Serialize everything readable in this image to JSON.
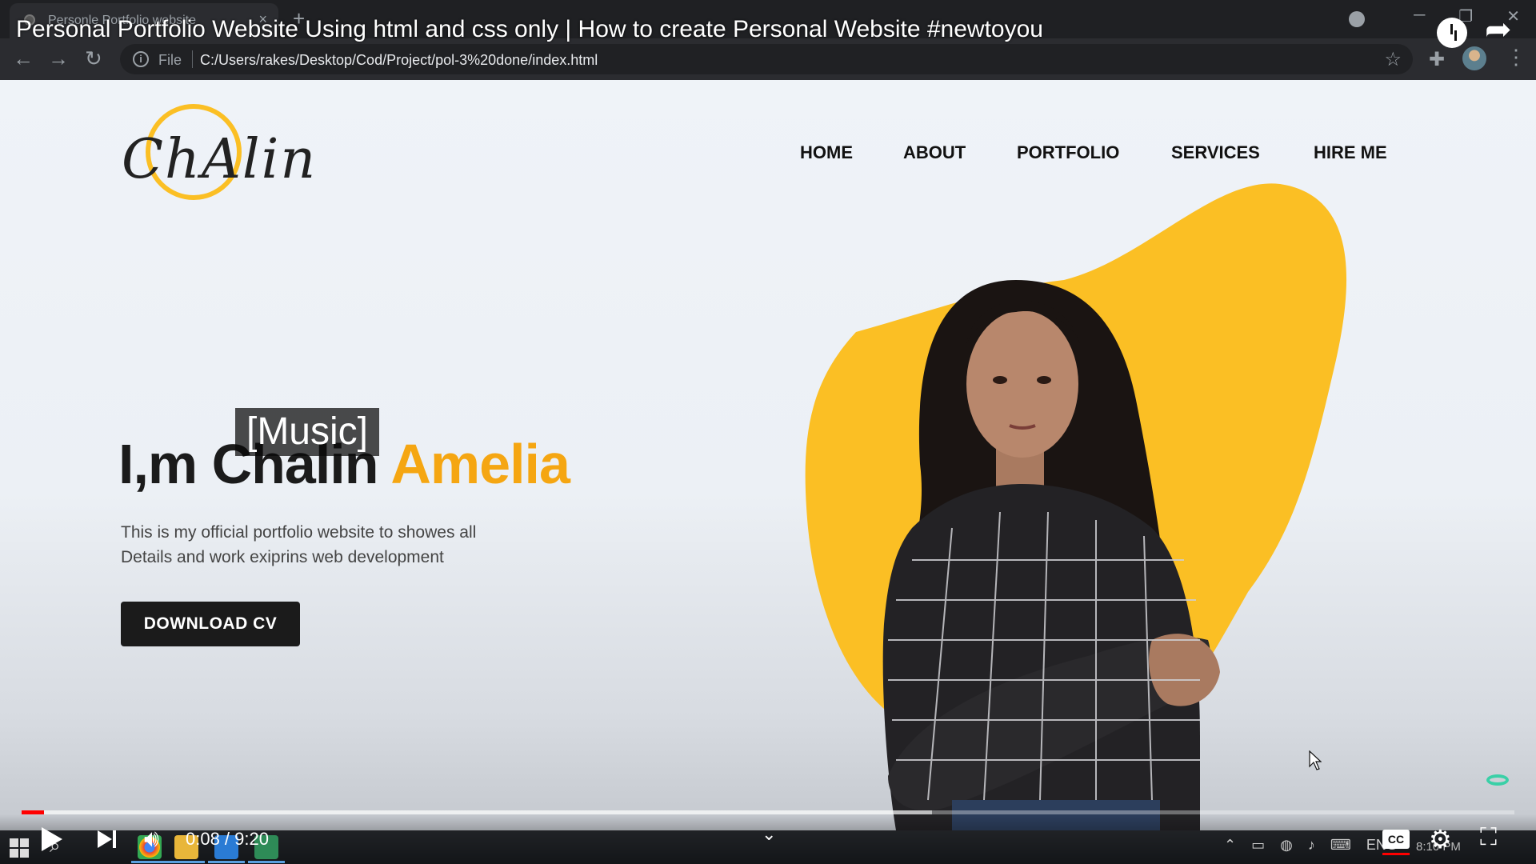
{
  "browser": {
    "tab_title": "Personle Portfolio website",
    "tab_close": "×",
    "new_tab": "+",
    "file_label": "File",
    "url": "C:/Users/rakes/Desktop/Cod/Project/pol-3%20done/index.html"
  },
  "site": {
    "logo_text": "ChAlin",
    "nav": [
      "HOME",
      "ABOUT",
      "PORTFOLIO",
      "SERVICES",
      "HIRE ME"
    ],
    "heading_prefix": "I,m Chalin",
    "heading_accent": "Amelia",
    "description_line1": "This is my official portfolio website to showes all",
    "description_line2": "Details and work exiprins web development",
    "cta_label": "DOWNLOAD CV",
    "accent_color": "#f5a612",
    "blob_color": "#fbbf24"
  },
  "video": {
    "title": "Personal Portfolio Website Using html and css only | How to create Personal Website #newtoyou",
    "caption": "[Music]",
    "time_display": "0:08 / 9:20",
    "progress_played_fraction": 0.015,
    "progress_loaded_fraction": 0.61,
    "cc_label": "CC"
  },
  "taskbar": {
    "language": "ENG",
    "clock": "8:10 PM"
  }
}
